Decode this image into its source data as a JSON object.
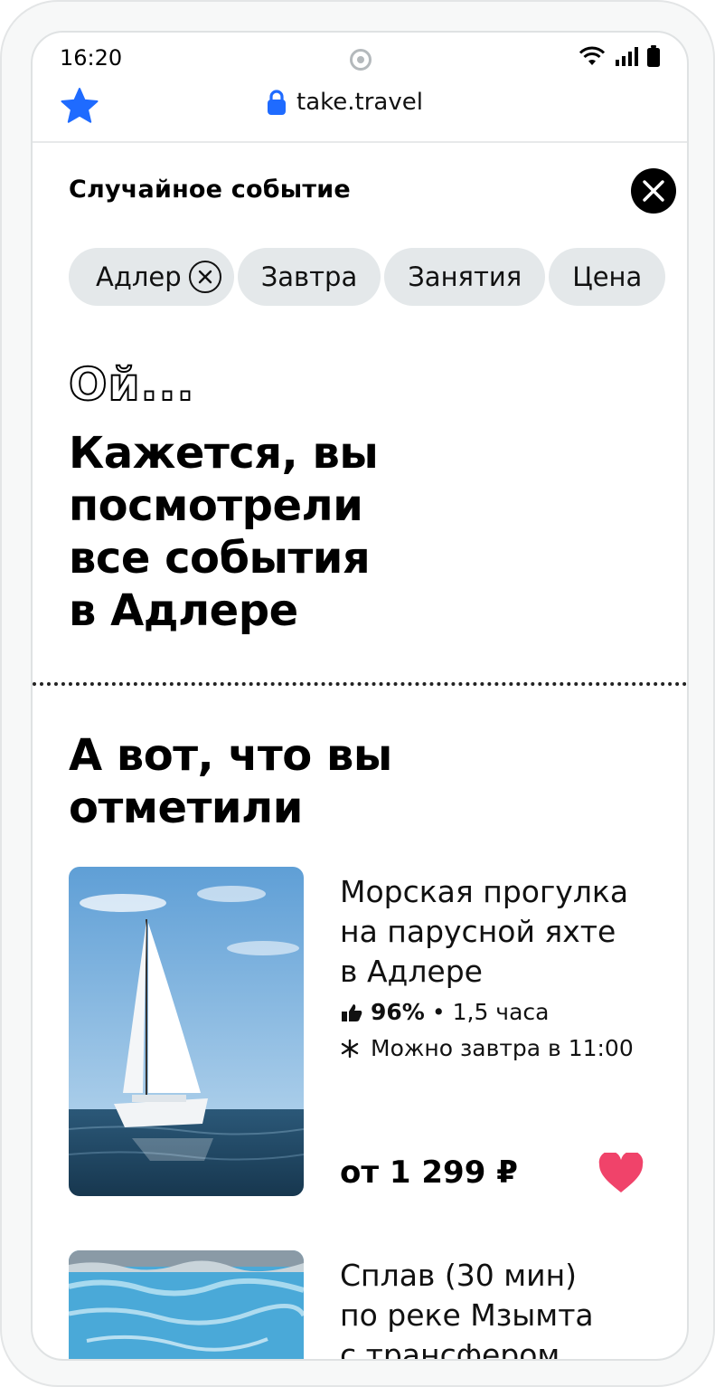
{
  "status_bar": {
    "time": "16:20"
  },
  "browser": {
    "url": "take.travel"
  },
  "sheet": {
    "title": "Случайное событие",
    "filters": [
      {
        "label": "Адлер",
        "active": true
      },
      {
        "label": "Завтра",
        "active": false
      },
      {
        "label": "Занятия",
        "active": false
      },
      {
        "label": "Цена",
        "active": false
      }
    ]
  },
  "empty_state": {
    "oops": "Ой...",
    "headline_lines": [
      "Кажется, вы",
      "посмотрели",
      "все события",
      "в Адлере"
    ]
  },
  "saved": {
    "title_lines": [
      "А вот, что вы",
      "отметили"
    ],
    "items": [
      {
        "title_lines": [
          "Морская прогулка",
          "на парусной яхте",
          "в Адлере"
        ],
        "rating": "96%",
        "separator": "•",
        "duration": "1,5 часа",
        "availability": "Можно завтра в 11:00",
        "price": "от 1 299 ₽",
        "favorite": true,
        "image": "sailboat-photo"
      },
      {
        "title_lines": [
          "Сплав (30 мин)",
          "по реке Мзымта",
          "с трансфером"
        ],
        "image": "rafting-photo"
      }
    ]
  },
  "colors": {
    "accent": "#1f6bff",
    "heart": "#f0436a",
    "chip_bg": "#e4e8ea"
  }
}
